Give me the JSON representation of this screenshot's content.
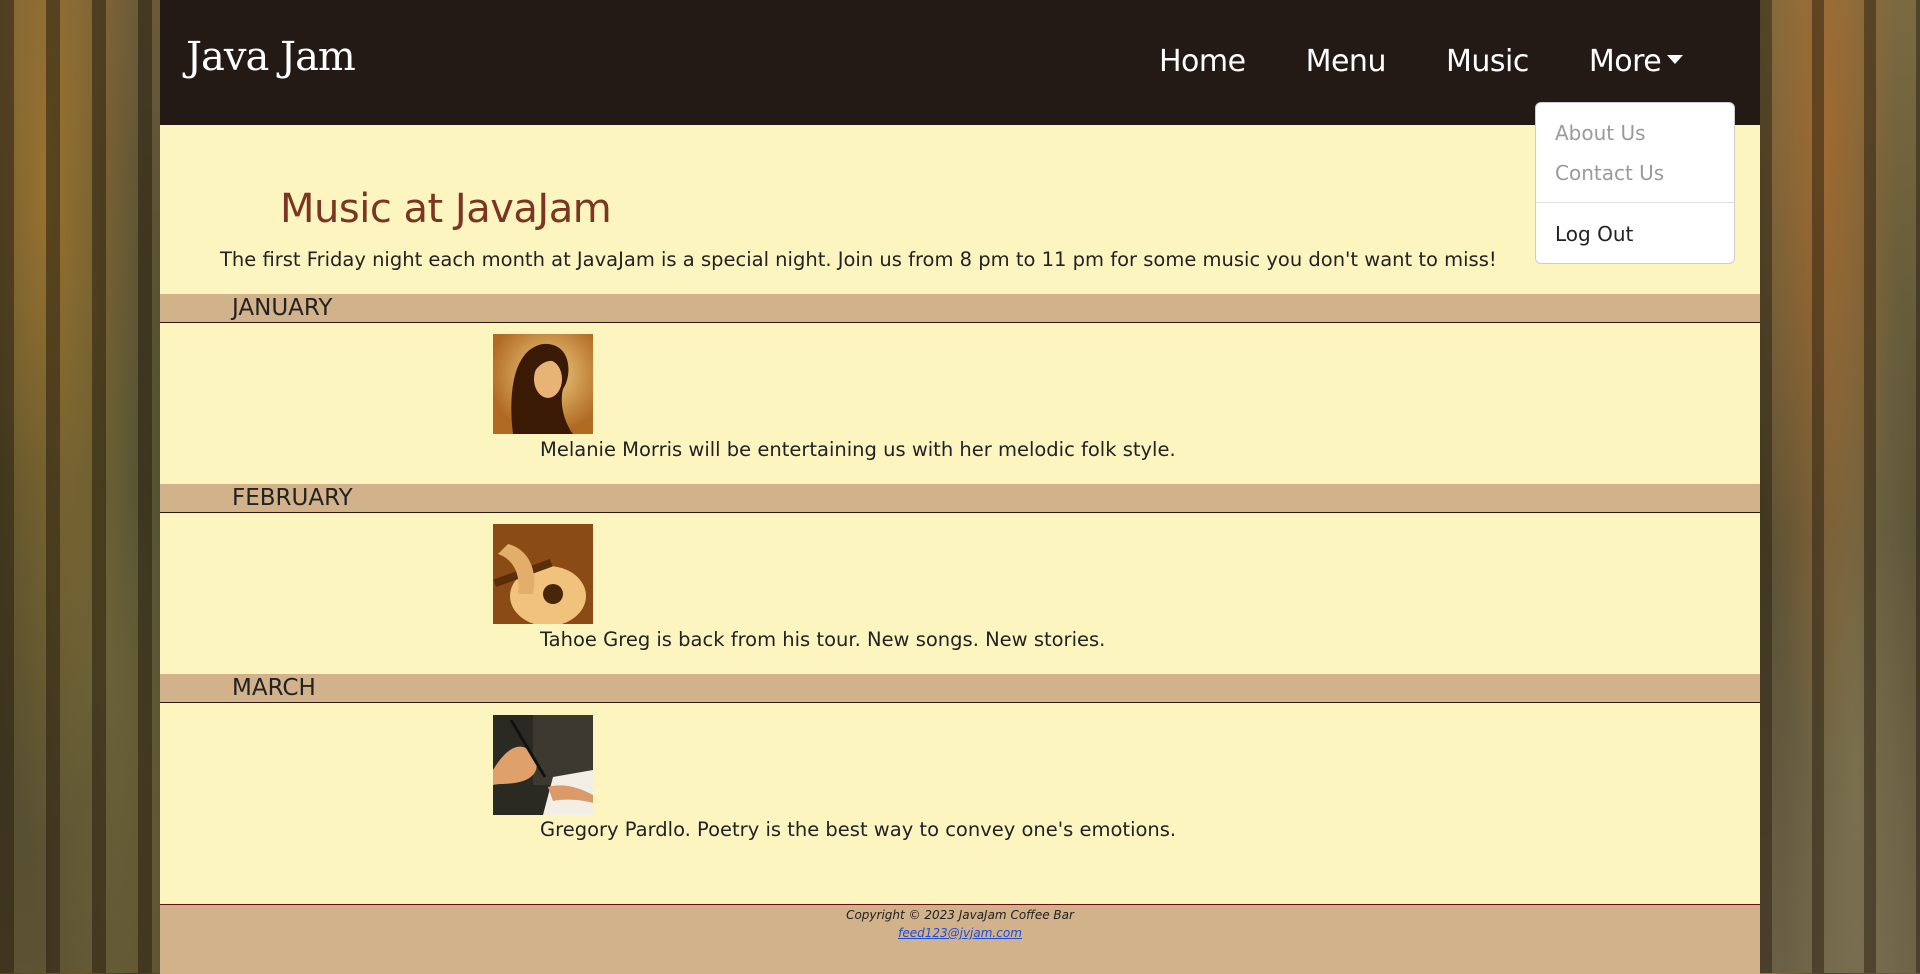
{
  "brand": {
    "logo_text": "Java Jam"
  },
  "nav": {
    "items": [
      "Home",
      "Menu",
      "Music"
    ],
    "more_label": "More",
    "dropdown": [
      "About Us",
      "Contact Us"
    ],
    "logout_label": "Log Out"
  },
  "main": {
    "title": "Music at JavaJam",
    "intro": "The first Friday night each month at JavaJam is a special night. Join us from 8 pm to 11 pm for some music you don't want to miss!",
    "months": [
      {
        "name": "JANUARY",
        "caption": "Melanie Morris will be entertaining us with her melodic folk style.",
        "image": "woman-singer-portrait"
      },
      {
        "name": "FEBRUARY",
        "caption": "Tahoe Greg is back from his tour. New songs. New stories.",
        "image": "acoustic-guitar"
      },
      {
        "name": "MARCH",
        "caption": "Gregory Pardlo. Poetry is the best way to convey one's emotions.",
        "image": "hand-writing-pen"
      }
    ]
  },
  "footer": {
    "copyright": "Copyright © 2023 JavaJam Coffee Bar",
    "email": "feed123@jvjam.com"
  },
  "colors": {
    "header_bg": "#231915",
    "page_bg": "#fdf5c0",
    "band_bg": "#d2b28a",
    "title_color": "#7b3522",
    "link_color": "#1a4ddb"
  }
}
